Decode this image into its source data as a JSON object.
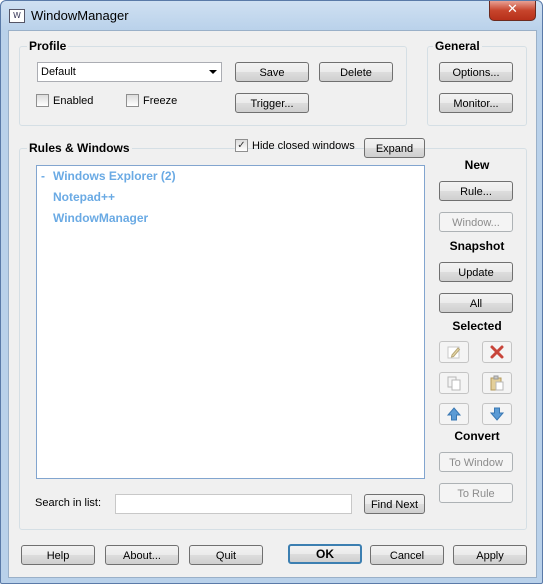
{
  "window": {
    "title": "WindowManager",
    "close_glyph": "✕"
  },
  "profile": {
    "title": "Profile",
    "selected": "Default",
    "save": "Save",
    "delete": "Delete",
    "trigger": "Trigger...",
    "enabled_label": "Enabled",
    "enabled_checked": false,
    "freeze_label": "Freeze",
    "freeze_checked": false
  },
  "general": {
    "title": "General",
    "options": "Options...",
    "monitor": "Monitor..."
  },
  "rules": {
    "title": "Rules & Windows",
    "hide_closed_label": "Hide closed windows",
    "hide_closed_checked": true,
    "expand": "Expand",
    "items": [
      {
        "toggle": "-",
        "label": "Windows Explorer (2)"
      },
      {
        "label": "Notepad++"
      },
      {
        "label": "WindowManager"
      }
    ],
    "search_label": "Search in list:",
    "search_value": "",
    "find_next": "Find Next"
  },
  "side": {
    "new_title": "New",
    "rule": "Rule...",
    "window": "Window...",
    "snapshot_title": "Snapshot",
    "update": "Update",
    "all": "All",
    "selected_title": "Selected",
    "convert_title": "Convert",
    "to_window": "To Window",
    "to_rule": "To Rule"
  },
  "footer": {
    "help": "Help",
    "about": "About...",
    "quit": "Quit",
    "ok": "OK",
    "cancel": "Cancel",
    "apply": "Apply"
  },
  "colors": {
    "tree_text": "#6aaae4",
    "delete_icon": "#c8453a",
    "arrow_icon": "#5b9bd5"
  }
}
